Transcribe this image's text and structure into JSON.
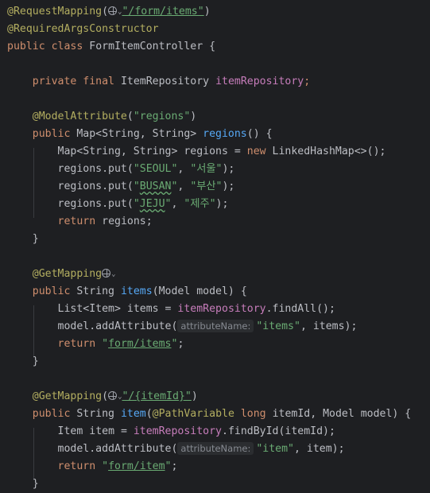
{
  "tokens": {
    "ann_request_mapping": "@RequestMapping",
    "path_items": "\"/form/items\"",
    "ann_required_args": "@RequiredArgsConstructor",
    "kw_public": "public",
    "kw_class": "class",
    "class_name": "FormItemController",
    "brace_open": "{",
    "brace_close": "}",
    "kw_private": "private",
    "kw_final": "final",
    "type_item_repository": "ItemRepository",
    "field_item_repository": "itemRepository",
    "ann_model_attribute": "@ModelAttribute",
    "str_regions": "\"regions\"",
    "map_type": "Map<String, String>",
    "fn_regions": "regions",
    "var_regions": "regions",
    "kw_new": "new",
    "linked_hash_map": "LinkedHashMap<>();",
    "regions_put": "regions.put(",
    "q": "\"",
    "seoul_key": "SEOUL",
    "seoul_val": "\"서울\"",
    "busan_key": "BUSAN",
    "busan_val": "\"부산\"",
    "jeju_key": "JEJU",
    "jeju_val": "\"제주\"",
    "kw_return": "return",
    "ann_get_mapping": "@GetMapping",
    "kw_string": "String",
    "fn_items": "items",
    "model_param": "(Model model)",
    "list_item_type": "List<Item>",
    "var_items": "items",
    "find_all": ".findAll();",
    "model_add_attr": "model.addAttribute(",
    "hint_attribute_name": "attributeName:",
    "str_items_attr": "\"items\"",
    "view_items": "form/items",
    "path_item_id": "\"/{itemId}\"",
    "fn_item": "item",
    "ann_path_variable": "@PathVariable",
    "kw_long": "long",
    "item_id_model_params": "itemId, Model model)",
    "item_type": "Item",
    "var_item": "item",
    "find_by_id": ".findById(itemId);",
    "str_item_attr": "\"item\"",
    "view_item": "form/item"
  },
  "icons": {
    "globe": "globe-icon",
    "chevron": "chevron-down-icon"
  },
  "colors": {
    "background": "#1e1f22",
    "annotation": "#b3ae60",
    "keyword": "#cf8e6d",
    "string": "#6aab73",
    "field": "#c77dbb",
    "method": "#56a8f5",
    "text": "#bcbec4"
  }
}
